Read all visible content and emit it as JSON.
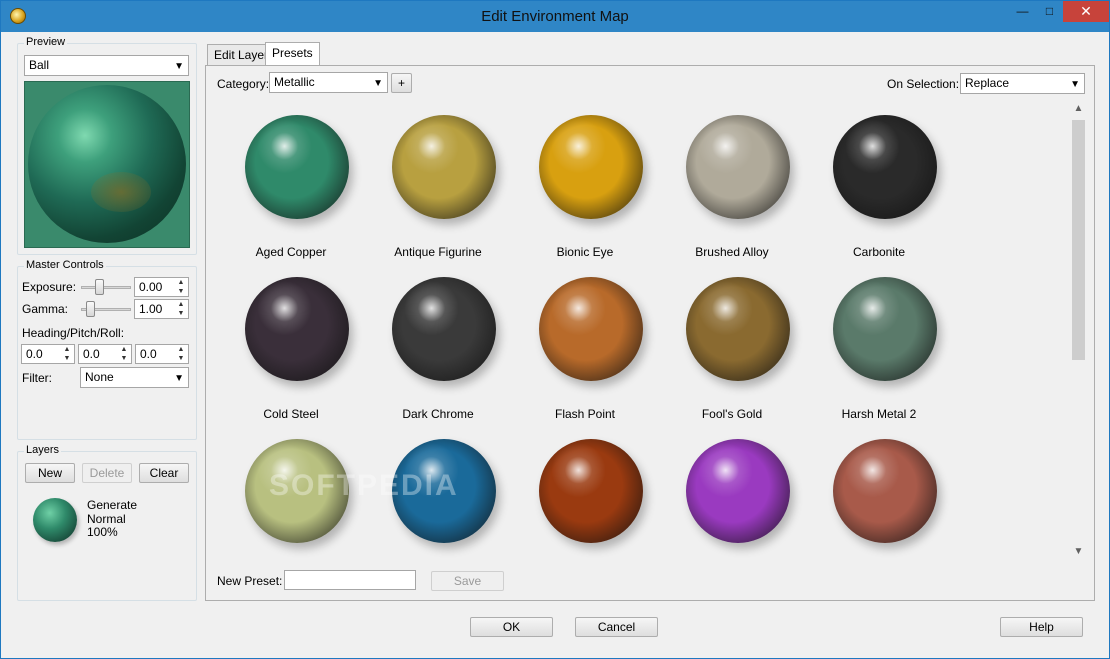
{
  "window": {
    "title": "Edit Environment Map"
  },
  "titlebar_buttons": {
    "minimize": "—",
    "maximize": "□",
    "close": "✕"
  },
  "preview": {
    "legend": "Preview",
    "mode": "Ball"
  },
  "master": {
    "legend": "Master Controls",
    "exposure_label": "Exposure:",
    "exposure_value": "0.00",
    "exposure_level": 0.35,
    "gamma_label": "Gamma:",
    "gamma_value": "1.00",
    "gamma_level": 0.12,
    "hpr_label": "Heading/Pitch/Roll:",
    "heading": "0.0",
    "pitch": "0.0",
    "roll": "0.0",
    "filter_label": "Filter:",
    "filter_value": "None"
  },
  "layers": {
    "legend": "Layers",
    "new_label": "New",
    "delete_label": "Delete",
    "clear_label": "Clear",
    "layer_name": "Generate",
    "layer_mode": "Normal",
    "layer_opacity": "100%"
  },
  "tabs": [
    {
      "label": "Edit Layer"
    },
    {
      "label": "Presets"
    }
  ],
  "presets_panel": {
    "category_label": "Category:",
    "category_value": "Metallic",
    "add_label": "+",
    "on_selection_label": "On Selection:",
    "on_selection_value": "Replace",
    "new_preset_label": "New Preset:",
    "new_preset_value": "",
    "save_label": "Save",
    "watermark": "SOFTPEDIA"
  },
  "presets": [
    {
      "name": "Aged Copper",
      "color": "#2f8a6a"
    },
    {
      "name": "Antique Figurine",
      "color": "#b8a040"
    },
    {
      "name": "Bionic Eye",
      "color": "#d8a010"
    },
    {
      "name": "Brushed Alloy",
      "color": "#b0aa9a"
    },
    {
      "name": "Carbonite",
      "color": "#2a2a2a"
    },
    {
      "name": "Cold Steel",
      "color": "#3a2f3a"
    },
    {
      "name": "Dark Chrome",
      "color": "#3a3a3a"
    },
    {
      "name": "Flash Point",
      "color": "#b86a2a"
    },
    {
      "name": "Fool's Gold",
      "color": "#8a6a30"
    },
    {
      "name": "Harsh Metal 2",
      "color": "#5a7a6a"
    },
    {
      "name": "",
      "color": "#b8c080"
    },
    {
      "name": "",
      "color": "#1a6a9a"
    },
    {
      "name": "",
      "color": "#9a3a10"
    },
    {
      "name": "",
      "color": "#9a3ac0"
    },
    {
      "name": "",
      "color": "#a85a4a"
    }
  ],
  "footer": {
    "ok_label": "OK",
    "cancel_label": "Cancel",
    "help_label": "Help"
  }
}
